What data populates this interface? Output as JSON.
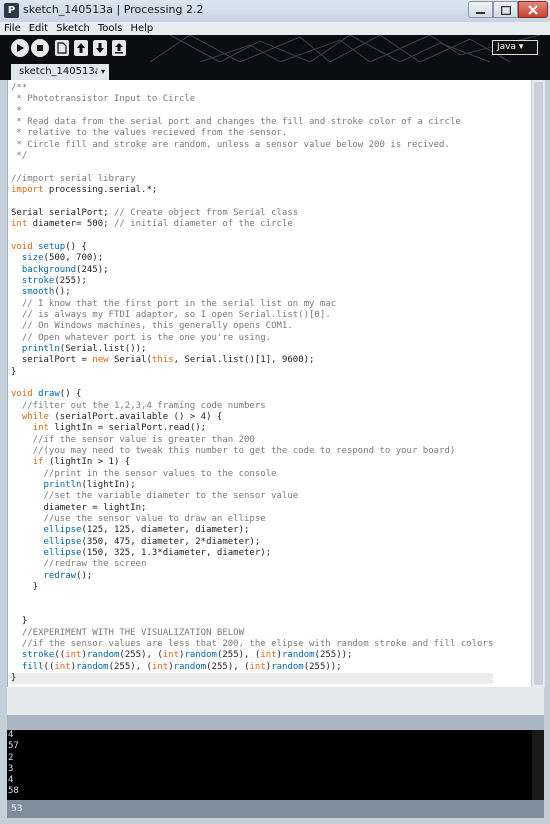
{
  "window": {
    "title": "sketch_140513a | Processing 2.2",
    "app_icon": "P"
  },
  "menu": [
    "File",
    "Edit",
    "Sketch",
    "Tools",
    "Help"
  ],
  "toolbar": {
    "icons": [
      "run-icon",
      "stop-icon",
      "new-icon",
      "open-icon",
      "save-icon",
      "export-icon"
    ],
    "mode": "Java ▾"
  },
  "tab": {
    "name": "sketch_140513a",
    "menu_glyph": "▾"
  },
  "code": [
    [
      [
        "/**",
        "c"
      ]
    ],
    [
      [
        " * Phototransistor Input to Circle",
        "c"
      ]
    ],
    [
      [
        " *",
        "c"
      ]
    ],
    [
      [
        " * Read data from the serial port and changes the fill and stroke color of a circle",
        "c"
      ]
    ],
    [
      [
        " * relative to the values recieved from the sensor.",
        "c"
      ]
    ],
    [
      [
        " * Circle fill and stroke are random, unless a sensor value below 200 is recived.",
        "c"
      ]
    ],
    [
      [
        " */",
        "c"
      ]
    ],
    [],
    [
      [
        "//import serial library",
        "c"
      ]
    ],
    [
      [
        "import",
        "k"
      ],
      [
        " processing.serial.*;",
        ""
      ]
    ],
    [],
    [
      [
        "Serial serialPort; ",
        ""
      ],
      [
        "// Create object from Serial class",
        "c"
      ]
    ],
    [
      [
        "int",
        "k"
      ],
      [
        " diameter= 500; ",
        ""
      ],
      [
        "// initial diameter of the circle",
        "c"
      ]
    ],
    [],
    [
      [
        "void",
        "k"
      ],
      [
        " ",
        ""
      ],
      [
        "setup",
        "f"
      ],
      [
        "() {",
        ""
      ]
    ],
    [
      [
        "  ",
        ""
      ],
      [
        "size",
        "f"
      ],
      [
        "(500, 700);",
        ""
      ]
    ],
    [
      [
        "  ",
        ""
      ],
      [
        "background",
        "f"
      ],
      [
        "(245);",
        ""
      ]
    ],
    [
      [
        "  ",
        ""
      ],
      [
        "stroke",
        "f"
      ],
      [
        "(255);",
        ""
      ]
    ],
    [
      [
        "  ",
        ""
      ],
      [
        "smooth",
        "f"
      ],
      [
        "();",
        ""
      ]
    ],
    [
      [
        "  // I know that the first port in the serial list on my mac",
        "c"
      ]
    ],
    [
      [
        "  // is always my FTDI adaptor, so I open Serial.list()[0].",
        "c"
      ]
    ],
    [
      [
        "  // On Windows machines, this generally opens COM1.",
        "c"
      ]
    ],
    [
      [
        "  // Open whatever port is the one you're using.",
        "c"
      ]
    ],
    [
      [
        "  ",
        ""
      ],
      [
        "println",
        "f"
      ],
      [
        "(Serial.list());",
        ""
      ]
    ],
    [
      [
        "  serialPort = ",
        ""
      ],
      [
        "new",
        "k"
      ],
      [
        " Serial(",
        ""
      ],
      [
        "this",
        "k"
      ],
      [
        ", Serial.list()[1], 9600);",
        ""
      ]
    ],
    [
      [
        "}",
        ""
      ]
    ],
    [],
    [
      [
        "void",
        "k"
      ],
      [
        " ",
        ""
      ],
      [
        "draw",
        "f"
      ],
      [
        "() {",
        ""
      ]
    ],
    [
      [
        "  //filter out the 1,2,3,4 framing code numbers",
        "c"
      ]
    ],
    [
      [
        "  ",
        ""
      ],
      [
        "while",
        "k"
      ],
      [
        " (serialPort.available () > 4) {",
        ""
      ]
    ],
    [
      [
        "    ",
        ""
      ],
      [
        "int",
        "k"
      ],
      [
        " lightIn = serialPort.read();",
        ""
      ]
    ],
    [
      [
        "    //if the sensor value is greater than 200",
        "c"
      ]
    ],
    [
      [
        "    //(you may need to tweak this number to get the code to respond to your board)",
        "c"
      ]
    ],
    [
      [
        "    ",
        ""
      ],
      [
        "if",
        "k"
      ],
      [
        " (lightIn > 1) {",
        ""
      ]
    ],
    [
      [
        "      //print in the sensor values to the console",
        "c"
      ]
    ],
    [
      [
        "      ",
        ""
      ],
      [
        "println",
        "f"
      ],
      [
        "(lightIn);",
        ""
      ]
    ],
    [
      [
        "      //set the variable diameter to the sensor value",
        "c"
      ]
    ],
    [
      [
        "      diameter = lightIn;",
        ""
      ]
    ],
    [
      [
        "      //use the sensor value to draw an ellipse",
        "c"
      ]
    ],
    [
      [
        "      ",
        ""
      ],
      [
        "ellipse",
        "f"
      ],
      [
        "(125, 125, diameter, diameter);",
        ""
      ]
    ],
    [
      [
        "      ",
        ""
      ],
      [
        "ellipse",
        "f"
      ],
      [
        "(350, 475, diameter, 2*diameter);",
        ""
      ]
    ],
    [
      [
        "      ",
        ""
      ],
      [
        "ellipse",
        "f"
      ],
      [
        "(150, 325, 1.3*diameter, diameter);",
        ""
      ]
    ],
    [
      [
        "      //redraw the screen",
        "c"
      ]
    ],
    [
      [
        "      ",
        ""
      ],
      [
        "redraw",
        "f"
      ],
      [
        "();",
        ""
      ]
    ],
    [
      [
        "    }",
        ""
      ]
    ],
    [],
    [],
    [
      [
        "  }",
        ""
      ]
    ],
    [
      [
        "  //EXPERIMENT WITH THE VISUALIZATION BELOW",
        "c"
      ]
    ],
    [
      [
        "  //if the sensor values are less that 200, the elipse with random stroke and fill colors",
        "c"
      ]
    ],
    [
      [
        "  ",
        ""
      ],
      [
        "stroke",
        "f"
      ],
      [
        "((",
        ""
      ],
      [
        "int",
        "k"
      ],
      [
        ")",
        ""
      ],
      [
        "random",
        "f"
      ],
      [
        "(255), (",
        ""
      ],
      [
        "int",
        "k"
      ],
      [
        ")",
        ""
      ],
      [
        "random",
        "f"
      ],
      [
        "(255), (",
        ""
      ],
      [
        "int",
        "k"
      ],
      [
        ")",
        ""
      ],
      [
        "random",
        "f"
      ],
      [
        "(255));",
        ""
      ]
    ],
    [
      [
        "  ",
        ""
      ],
      [
        "fill",
        "f"
      ],
      [
        "((",
        ""
      ],
      [
        "int",
        "k"
      ],
      [
        ")",
        ""
      ],
      [
        "random",
        "f"
      ],
      [
        "(255), (",
        ""
      ],
      [
        "int",
        "k"
      ],
      [
        ")",
        ""
      ],
      [
        "random",
        "f"
      ],
      [
        "(255), (",
        ""
      ],
      [
        "int",
        "k"
      ],
      [
        ")",
        ""
      ],
      [
        "random",
        "f"
      ],
      [
        "(255));",
        ""
      ]
    ],
    [
      [
        "}",
        ""
      ]
    ]
  ],
  "console": [
    "4",
    "57",
    "2",
    "3",
    "4",
    "58"
  ],
  "status": {
    "line": "53"
  }
}
